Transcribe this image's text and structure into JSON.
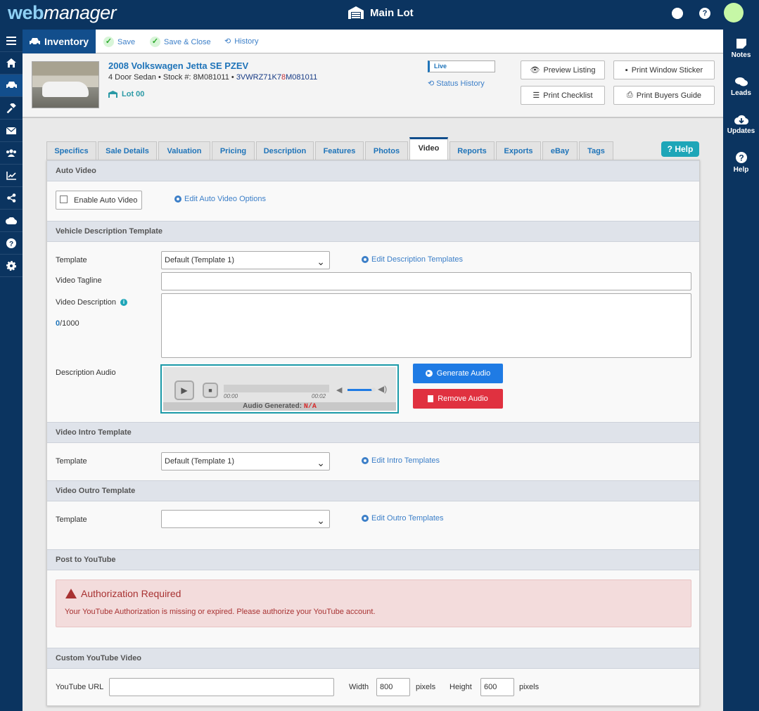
{
  "topbar": {
    "logo_web": "web",
    "logo_manager": "manager",
    "lot_name": "Main Lot",
    "globe_icon": "🌐",
    "help_icon": "?"
  },
  "rightnav": [
    {
      "label": "Notes",
      "icon": "notes-icon"
    },
    {
      "label": "Leads",
      "icon": "chat-icon"
    },
    {
      "label": "Updates",
      "icon": "cloud-download-icon"
    },
    {
      "label": "Help",
      "icon": "question-icon"
    }
  ],
  "actionbar": {
    "section": "Inventory",
    "save": "Save",
    "save_close": "Save & Close",
    "history": "History"
  },
  "vehicle": {
    "title": "2008 Volkswagen Jetta SE PZEV",
    "body": "4 Door Sedan",
    "stock_label": "Stock #:",
    "stock": "8M081011",
    "vin_a": "3VWRZ71K7",
    "vin_b": "8",
    "vin_c": "M081011",
    "lot": "Lot 00",
    "status": "Live",
    "status_history": "Status History"
  },
  "header_buttons": {
    "preview": "Preview Listing",
    "window_sticker": "Print Window Sticker",
    "checklist": "Print Checklist",
    "buyers_guide": "Print Buyers Guide"
  },
  "tabs": [
    "Specifics",
    "Sale Details",
    "Valuation",
    "Pricing",
    "Description",
    "Features",
    "Photos",
    "Video",
    "Reports",
    "Exports",
    "eBay",
    "Tags"
  ],
  "active_tab": "Video",
  "help_label": "Help",
  "auto_video": {
    "header": "Auto Video",
    "enable_label": "Enable Auto Video",
    "edit_link": "Edit Auto Video Options"
  },
  "description_template": {
    "header": "Vehicle Description Template",
    "template_label": "Template",
    "template_value": "Default (Template 1)",
    "edit_link": "Edit Description Templates",
    "tagline_label": "Video Tagline",
    "tagline_value": "",
    "description_label": "Video Description",
    "char_count": "0",
    "char_max": "/1000",
    "audio_label": "Description Audio",
    "time_start": "00:00",
    "time_end": "00:02",
    "audio_generated_label": "Audio Generated:",
    "audio_generated_value": "N/A",
    "generate_audio": "Generate Audio",
    "remove_audio": "Remove Audio"
  },
  "intro_template": {
    "header": "Video Intro Template",
    "template_label": "Template",
    "template_value": "Default (Template 1)",
    "edit_link": "Edit Intro Templates"
  },
  "outro_template": {
    "header": "Video Outro Template",
    "template_label": "Template",
    "template_value": "",
    "edit_link": "Edit Outro Templates"
  },
  "youtube": {
    "header": "Post to YouTube",
    "alert_title": "Authorization Required",
    "alert_message": "Your YouTube Authorization is missing or expired. Please authorize your YouTube account."
  },
  "custom_youtube": {
    "header": "Custom YouTube Video",
    "url_label": "YouTube URL",
    "url_value": "",
    "width_label": "Width",
    "width_value": "800",
    "pixels1": "pixels",
    "height_label": "Height",
    "height_value": "600",
    "pixels2": "pixels"
  },
  "colors": {
    "nav_bg": "#0b3460",
    "accent": "#124e8c",
    "link": "#3c7fc8",
    "danger": "#e03140",
    "primary": "#1f7be4",
    "avatar": "#c6f7a6"
  }
}
